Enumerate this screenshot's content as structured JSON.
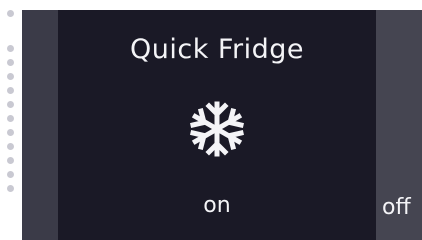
{
  "card": {
    "title": "Quick Fridge",
    "icon": "snowflake-icon",
    "status": "on"
  },
  "next_card": {
    "status": "off"
  },
  "pager": {
    "count": 13,
    "active_index": 1
  },
  "colors": {
    "panel": "#1a1926",
    "rail": "#3b3b48",
    "side": "#454551",
    "text": "#f4f4f7"
  }
}
